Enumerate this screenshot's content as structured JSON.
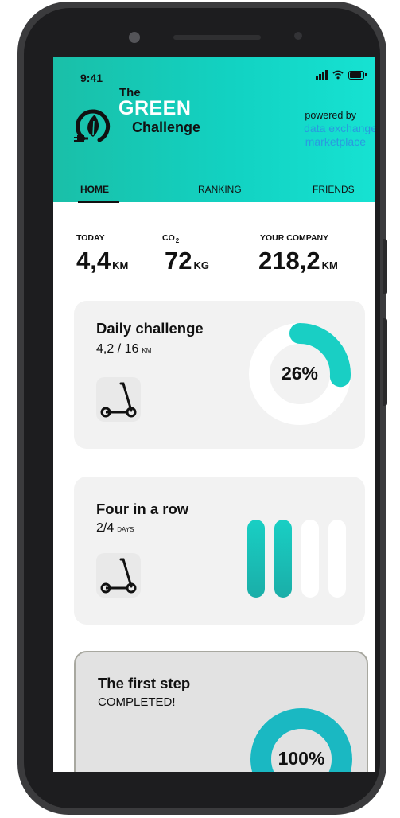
{
  "status_bar": {
    "time": "9:41"
  },
  "brand": {
    "the": "The",
    "green": "GREEN",
    "challenge": "Challenge",
    "powered_by": "powered by",
    "partner_line1": "data exchange",
    "partner_line2": "marketplace"
  },
  "tabs": [
    {
      "label": "HOME",
      "active": true
    },
    {
      "label": "RANKING",
      "active": false
    },
    {
      "label": "FRIENDS",
      "active": false
    }
  ],
  "stats": {
    "today": {
      "label": "TODAY",
      "value": "4,4",
      "unit": "KM"
    },
    "co2": {
      "label": "CO",
      "label_sub": "2",
      "value": "72",
      "unit": "KG"
    },
    "company": {
      "label": "YOUR COMPANY",
      "value": "218,2",
      "unit": "KM"
    }
  },
  "cards": [
    {
      "title": "Daily challenge",
      "progress_text": "4,2 / 16",
      "progress_unit": "KM",
      "percent_label": "26%",
      "progress_fraction": 0.26,
      "icon": "scooter-icon"
    },
    {
      "title": "Four in a row",
      "progress_text": "2/4",
      "progress_unit": "DAYS",
      "days_completed": 2,
      "days_total": 4,
      "icon": "scooter-icon"
    },
    {
      "title": "The first step",
      "status": "COMPLETED!",
      "percent_label": "100%",
      "progress_fraction": 1.0
    }
  ],
  "colors": {
    "accent": "#19cfc4",
    "accent_dark": "#1aaea8",
    "card_bg": "#f2f2f2",
    "partner_blue": "#2a9ae0"
  }
}
